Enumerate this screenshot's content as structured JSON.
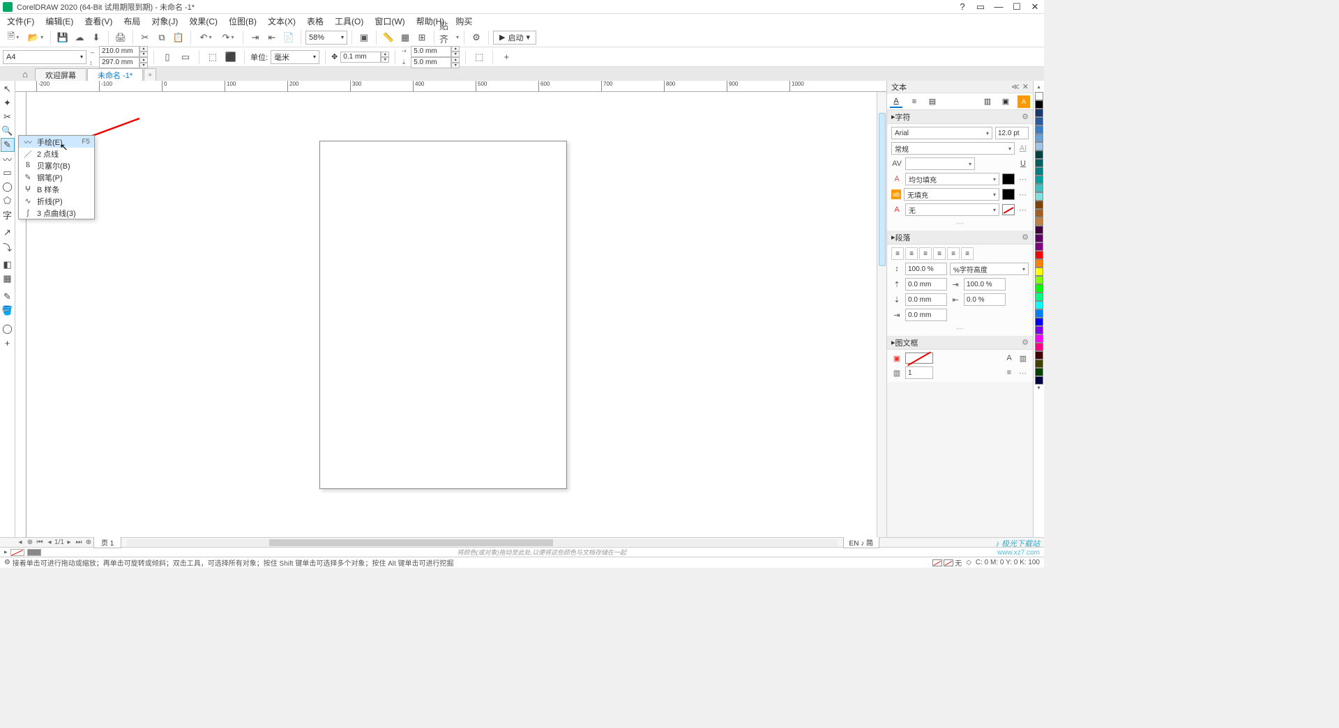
{
  "titlebar": {
    "title": "CorelDRAW 2020 (64-Bit 试用期限到期) - 未命名 -1*"
  },
  "menubar": [
    "文件(F)",
    "编辑(E)",
    "查看(V)",
    "布局",
    "对象(J)",
    "效果(C)",
    "位图(B)",
    "文本(X)",
    "表格",
    "工具(O)",
    "窗口(W)",
    "帮助(H)",
    "购买"
  ],
  "toolbar": {
    "zoom": "58%",
    "snap_label": "贴齐(I)",
    "launch": "启动"
  },
  "propbar": {
    "page_size": "A4",
    "width": "210.0 mm",
    "height": "297.0 mm",
    "units_label": "单位:",
    "units": "毫米",
    "nudge": "0.1 mm",
    "dup_x": "5.0 mm",
    "dup_y": "5.0 mm"
  },
  "tabs": {
    "welcome": "欢迎屏幕",
    "doc": "未命名 -1*"
  },
  "ruler_ticks": [
    "-200",
    "-100",
    "0",
    "100",
    "200",
    "300",
    "400",
    "500",
    "600",
    "700",
    "800",
    "900",
    "1000"
  ],
  "flyout": {
    "items": [
      {
        "icon": "〰",
        "label": "手绘(E)",
        "shortcut": "F5"
      },
      {
        "icon": "／",
        "label": "2 点线"
      },
      {
        "icon": "Ⲃ",
        "label": "贝塞尔(B)"
      },
      {
        "icon": "✎",
        "label": "钢笔(P)"
      },
      {
        "icon": "ⵖ",
        "label": "B 样条"
      },
      {
        "icon": "∿",
        "label": "折线(P)"
      },
      {
        "icon": "∫",
        "label": "3 点曲线(3)"
      }
    ]
  },
  "docker": {
    "title": "文本",
    "char_hdr": "字符",
    "font": "Arial",
    "size": "12.0 pt",
    "style": "常规",
    "kerning_placeholder": "A|V",
    "fill_label": "均匀填充",
    "nofill_label": "无填充",
    "outline_label": "无",
    "para_hdr": "段落",
    "line_sp": "100.0 %",
    "char_h": "%字符高度",
    "before": "0.0 mm",
    "after": "0.0 mm",
    "left": "0.0 mm",
    "indent_pct": "100.0 %",
    "indent_pct2": "0.0 %",
    "frame_hdr": "图文框",
    "cols": "1"
  },
  "palette_colors": [
    "#ffffff",
    "#000000",
    "#1a3a6e",
    "#2a5aa0",
    "#3b7dc9",
    "#6aa0d8",
    "#a0c4e8",
    "#004040",
    "#006060",
    "#008080",
    "#00a0a0",
    "#40c0c0",
    "#80e0e0",
    "#804000",
    "#a06020",
    "#c08040",
    "#400040",
    "#600060",
    "#800080",
    "#ff0000",
    "#ff8000",
    "#ffff00",
    "#80ff00",
    "#00ff00",
    "#00ff80",
    "#00ffff",
    "#0080ff",
    "#0000ff",
    "#8000ff",
    "#ff00ff",
    "#ff0080",
    "#400000",
    "#404000",
    "#004000",
    "#000040"
  ],
  "pagenav": {
    "page_label": "页 1",
    "ime": "EN ♪ 简"
  },
  "colorrow": {
    "hint": "将颜色(或对象)拖动至此处,以便将这些颜色与文档存储在一起"
  },
  "statusbar": {
    "hint": "接着单击可进行拖动或缩放；再单击可旋转或倾斜；双击工具，可选择所有对象；按住 Shift 键单击可选择多个对象；按住 Alt 键单击可进行挖掘",
    "none_label": "无",
    "cmyk": "C: 0 M: 0 Y: 0 K: 100"
  },
  "watermark": {
    "l1": "♪ 极光下载站",
    "l2": "www.xz7.com"
  }
}
